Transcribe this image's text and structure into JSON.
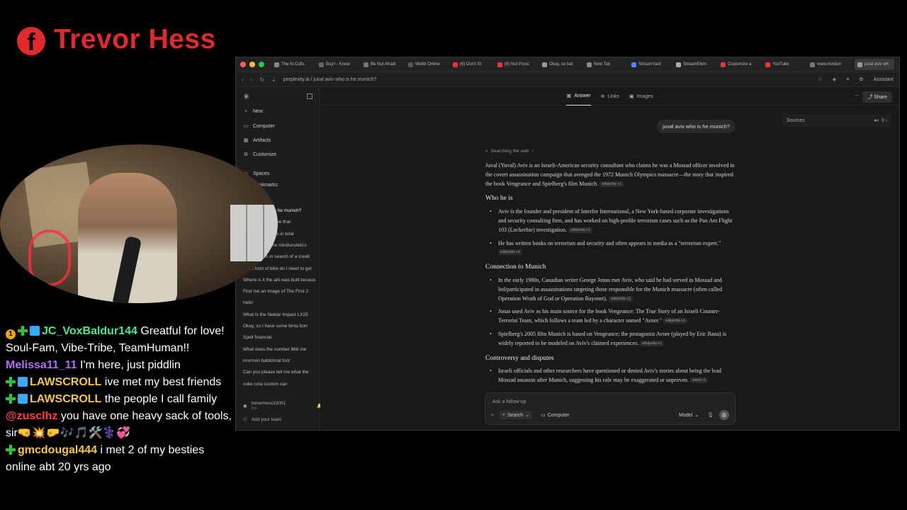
{
  "overlay": {
    "fb_glyph": "f",
    "stream_name": "Trevor Hess"
  },
  "chat": [
    {
      "user": "JC_VoxBaldur144",
      "user_color": "#3ef08a",
      "badges": [
        "one",
        "plus",
        "cube"
      ],
      "text": "Greatful for love! Soul-Fam, Vibe-Tribe, TeamHuman!!"
    },
    {
      "user": "Melissa11_11",
      "user_color": "#b46cff",
      "badges": [],
      "text": "I'm here, just piddlin"
    },
    {
      "user": "LAWSCROLL",
      "user_color": "#f5c842",
      "badges": [
        "plus",
        "cube"
      ],
      "text": "ive met my best friends"
    },
    {
      "user": "LAWSCROLL",
      "user_color": "#f5c842",
      "badges": [
        "plus",
        "cube"
      ],
      "text": "the people I call family"
    },
    {
      "user": "@zusclhz",
      "user_color": "#ff4040",
      "badges": [],
      "text": "you have one heavy sack of tools, sir🤜💥🤛🎶🎵🛠️⚕️💞"
    },
    {
      "user": "gmcdougal444",
      "user_color": "#f5c842",
      "badges": [
        "plus"
      ],
      "text": "i met 2 of my besties online abt 20 yrs ago"
    }
  ],
  "browser": {
    "tabs": [
      {
        "label": "The AI Cults",
        "color": "#888"
      },
      {
        "label": "Buy'r - Know",
        "color": "#666"
      },
      {
        "label": "Be Not Afraid",
        "color": "#777"
      },
      {
        "label": "Webb Online",
        "color": "#555"
      },
      {
        "label": "(6) Don't St",
        "color": "#e33"
      },
      {
        "label": "(6) Not Possi",
        "color": "#e33"
      },
      {
        "label": "Okay, so tod",
        "color": "#999"
      },
      {
        "label": "New Tab",
        "color": "#888"
      },
      {
        "label": "StreamYard",
        "color": "#4a8cff"
      },
      {
        "label": "StreamElem",
        "color": "#aaa"
      },
      {
        "label": "Customize a",
        "color": "#e33"
      },
      {
        "label": "YouTube",
        "color": "#e33"
      },
      {
        "label": "www.mindun",
        "color": "#777"
      },
      {
        "label": "juval aviv wh",
        "color": "#999"
      }
    ],
    "new_tab": "+",
    "url": "perplexity.ai / juval aviv who is he munich?",
    "assistant_label": "Assistant"
  },
  "sidebar": {
    "items": [
      {
        "icon": "+",
        "label": "New"
      },
      {
        "icon": "▭",
        "label": "Computer"
      },
      {
        "icon": "▦",
        "label": "Artifacts"
      },
      {
        "icon": "⚙",
        "label": "Customize"
      }
    ],
    "spaces_label": "Spaces",
    "bookmarks_label": "Bookmarks",
    "history": [
      "juval aviv who is he munich?",
      "Write a monologue that",
      "Count total words in total",
      "Do you know the mindunvield.c",
      "Okay, so I'm in search of a creati",
      "What kind of bike do I need to get",
      "Where is it the ark was built because ev",
      "Find me an image of The First 2",
      "hello",
      "What is the Nektar Impact LX25",
      "Okay, so I have some binia borr",
      "Spell financial.",
      "What does the number 888 me",
      "mormon babtizmal font",
      "Can you please tell me what the",
      "coke cola custom can"
    ],
    "user": "treverhess33001",
    "user_plan": "Pro",
    "add_team": "Add your team"
  },
  "main": {
    "tabs": [
      "Answer",
      "Links",
      "Images"
    ],
    "share": "Share",
    "sources_label": "Sources",
    "sources_count": "9",
    "query": "juval aviv who is he munich?",
    "searching": "Searching the web",
    "intro": "Juval (Yuval) Aviv is an Israeli-American security consultant who claims he was a Mossad officer involved in the covert assassination campaign that avenged the 1972 Munich Olympics massacre—the story that inspired the book Vengeance and Spielberg's film Munich.",
    "intro_cite": "wikipedia +1",
    "sections": [
      {
        "heading": "Who he is",
        "bullets": [
          {
            "text": "Aviv is the founder and president of Interfor International, a New York-based corporate investigations and security consulting firm, and has worked on high-profile terrorism cases such as the Pan Am Flight 103 (Lockerbie) investigation.",
            "cite": "wikipedia +1"
          },
          {
            "text": "He has written books on terrorism and security and often appears in media as a \"terrorism expert.\"",
            "cite": "wikipedia +1"
          }
        ]
      },
      {
        "heading": "Connection to Munich",
        "bullets": [
          {
            "text": "In the early 1980s, Canadian writer George Jonas met Aviv, who said he had served in Mossad and led/participated in assassinations targeting those responsible for the Munich massacre (often called Operation Wrath of God or Operation Bayonet).",
            "cite": "wikipedia +1"
          },
          {
            "text": "Jonas used Aviv as his main source for the book Vengeance: The True Story of an Israeli Counter-Terrorist Team, which follows a team led by a character named \"Avner.\"",
            "cite": "wikipedia +1"
          },
          {
            "text": "Spielberg's 2005 film Munich is based on Vengeance; the protagonist Avner (played by Eric Bana) is widely reported to be modeled on Aviv's claimed experiences.",
            "cite": "wikipedia +1"
          }
        ]
      },
      {
        "heading": "Controversy and disputes",
        "bullets": [
          {
            "text": "Israeli officials and other researchers have questioned or denied Aviv's stories about being the lead Mossad assassin after Munich, suggesting his role may be exaggerated or unproven.",
            "cite": "wired +1"
          }
        ]
      }
    ],
    "composer": {
      "placeholder": "Ask a follow-up",
      "search_label": "Search",
      "computer_label": "Computer",
      "model_label": "Model"
    }
  }
}
